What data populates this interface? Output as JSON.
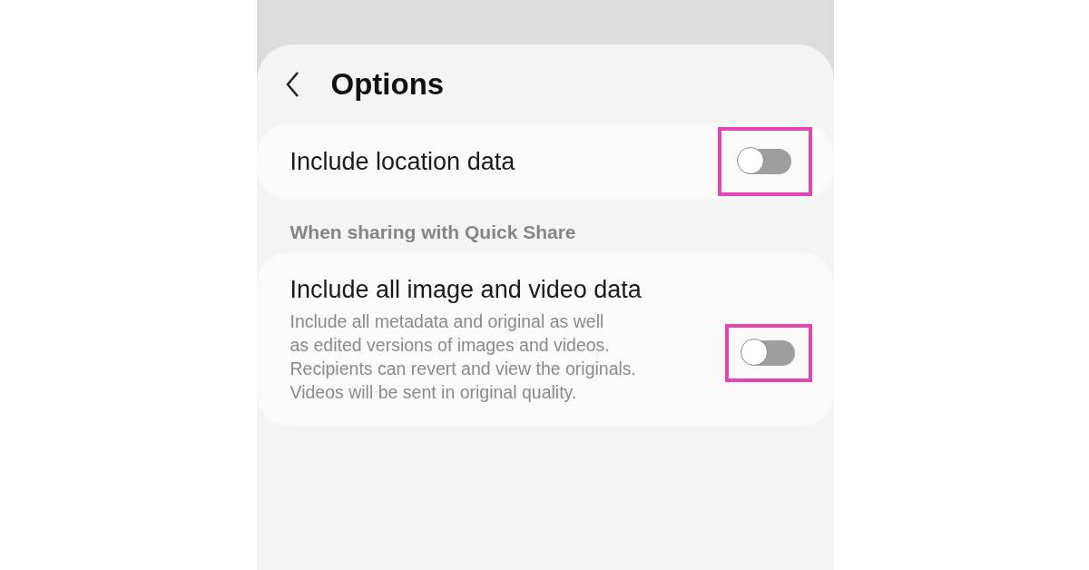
{
  "header": {
    "title": "Options"
  },
  "settings": [
    {
      "kind": "toggle",
      "title": "Include location data",
      "on": false,
      "highlighted": true
    }
  ],
  "section": {
    "label": "When sharing with Quick Share",
    "settings": [
      {
        "kind": "toggle",
        "title": "Include all image and video data",
        "description": [
          "Include all metadata and original as well",
          "as edited versions of images and videos.",
          "Recipients can revert and view the originals.",
          "Videos will be sent in original quality."
        ],
        "on": false,
        "highlighted": true
      }
    ]
  }
}
